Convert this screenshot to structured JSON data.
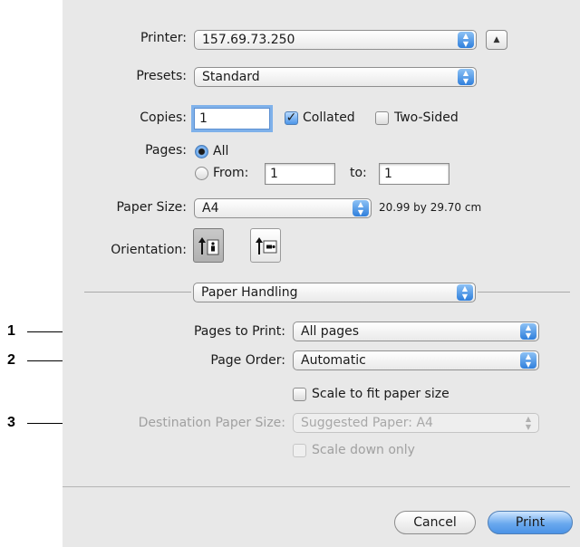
{
  "printer": {
    "label": "Printer:",
    "value": "157.69.73.250"
  },
  "presets": {
    "label": "Presets:",
    "value": "Standard"
  },
  "copies": {
    "label": "Copies:",
    "value": "1",
    "collated_label": "Collated",
    "collated_checked": true,
    "two_sided_label": "Two-Sided",
    "two_sided_checked": false
  },
  "pages": {
    "label": "Pages:",
    "all_label": "All",
    "from_label": "From:",
    "from_value": "1",
    "to_label": "to:",
    "to_value": "1",
    "selected": "All"
  },
  "paper_size": {
    "label": "Paper Size:",
    "value": "A4",
    "dimensions": "20.99 by 29.70 cm"
  },
  "orientation": {
    "label": "Orientation:",
    "selected": "portrait"
  },
  "section": {
    "value": "Paper Handling"
  },
  "pages_to_print": {
    "label": "Pages to Print:",
    "value": "All pages"
  },
  "page_order": {
    "label": "Page Order:",
    "value": "Automatic"
  },
  "scale_to_fit": {
    "label": "Scale to fit paper size",
    "checked": false
  },
  "destination": {
    "label": "Destination Paper Size:",
    "value": "Suggested Paper: A4"
  },
  "scale_down": {
    "label": "Scale down only",
    "checked": false
  },
  "buttons": {
    "cancel": "Cancel",
    "print": "Print"
  },
  "callouts": [
    "1",
    "2",
    "3"
  ],
  "colors": {
    "accent": "#4b93e6",
    "panel": "#e8e8e8"
  }
}
